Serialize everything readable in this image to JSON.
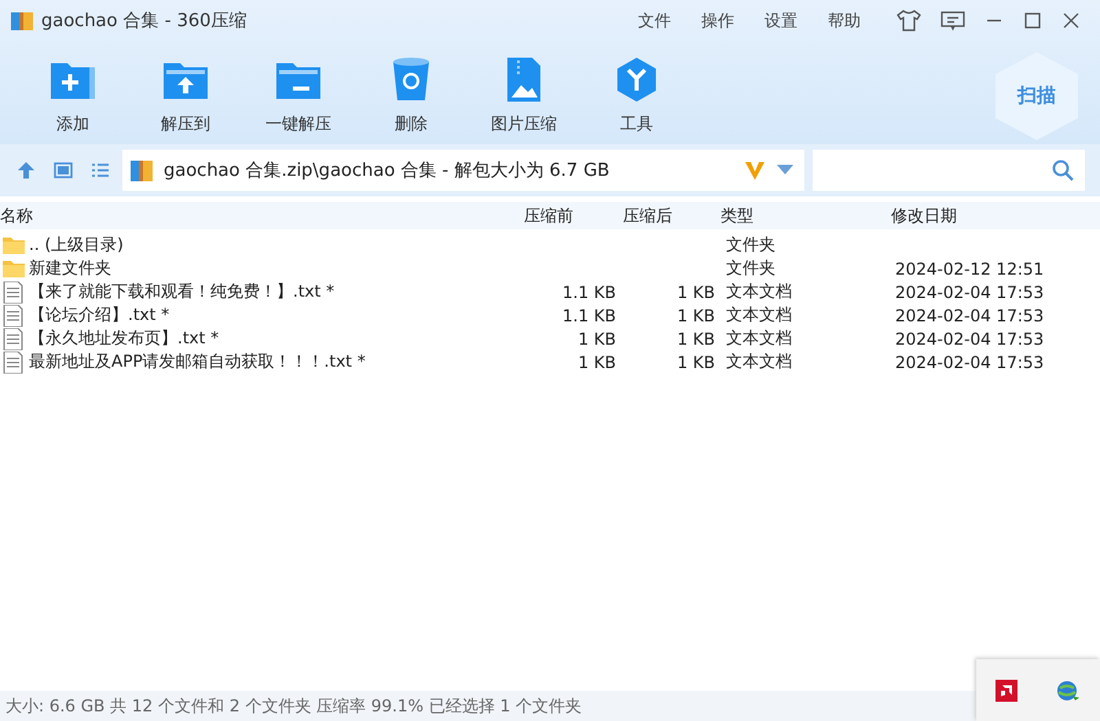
{
  "window": {
    "title": "gaochao 合集 - 360压缩"
  },
  "menu": [
    "文件",
    "操作",
    "设置",
    "帮助"
  ],
  "toolbar": [
    {
      "label": "添加",
      "kind": "add"
    },
    {
      "label": "解压到",
      "kind": "extract"
    },
    {
      "label": "一键解压",
      "kind": "oneclick"
    },
    {
      "label": "删除",
      "kind": "delete"
    },
    {
      "label": "图片压缩",
      "kind": "image"
    },
    {
      "label": "工具",
      "kind": "tools"
    }
  ],
  "scan_button": "扫描",
  "address": {
    "path": "gaochao 合集.zip\\gaochao 合集 - 解包大小为 6.7 GB"
  },
  "table": {
    "columns": [
      "名称",
      "压缩前",
      "压缩后",
      "类型",
      "修改日期"
    ],
    "rows": [
      {
        "kind": "folder",
        "name": ".. (上级目录)",
        "before": "",
        "after": "",
        "type": "文件夹",
        "date": ""
      },
      {
        "kind": "folder",
        "name": "新建文件夹",
        "before": "",
        "after": "",
        "type": "文件夹",
        "date": "2024-02-12 12:51"
      },
      {
        "kind": "file",
        "name": "【来了就能下载和观看！纯免费！】.txt *",
        "before": "1.1 KB",
        "after": "1 KB",
        "type": "文本文档",
        "date": "2024-02-04 17:53"
      },
      {
        "kind": "file",
        "name": "【论坛介绍】.txt *",
        "before": "1.1 KB",
        "after": "1 KB",
        "type": "文本文档",
        "date": "2024-02-04 17:53"
      },
      {
        "kind": "file",
        "name": "【永久地址发布页】.txt *",
        "before": "1 KB",
        "after": "1 KB",
        "type": "文本文档",
        "date": "2024-02-04 17:53"
      },
      {
        "kind": "file",
        "name": "最新地址及APP请发邮箱自动获取！！！.txt *",
        "before": "1 KB",
        "after": "1 KB",
        "type": "文本文档",
        "date": "2024-02-04 17:53"
      }
    ]
  },
  "status_bar": "大小: 6.6 GB 共 12 个文件和 2 个文件夹 压缩率 99.1% 已经选择 1 个文件夹"
}
